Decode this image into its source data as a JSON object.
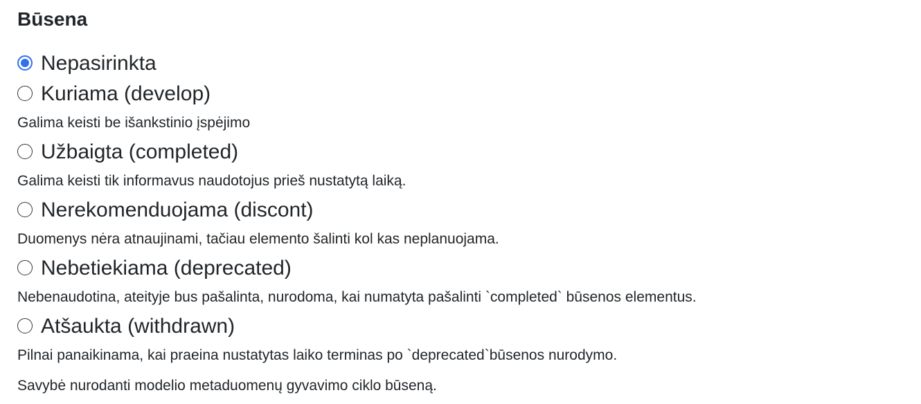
{
  "field": {
    "legend": "Būsena",
    "options": [
      {
        "label": "Nepasirinkta",
        "description": "",
        "checked": true
      },
      {
        "label": "Kuriama (develop)",
        "description": "Galima keisti be išankstinio įspėjimo",
        "checked": false
      },
      {
        "label": "Užbaigta (completed)",
        "description": "Galima keisti tik informavus naudotojus prieš nustatytą laiką.",
        "checked": false
      },
      {
        "label": "Nerekomenduojama (discont)",
        "description": "Duomenys nėra atnaujinami, tačiau elemento šalinti kol kas neplanuojama.",
        "checked": false
      },
      {
        "label": "Nebetiekiama (deprecated)",
        "description": "Nebenaudotina, ateityje bus pašalinta, nurodoma, kai numatyta pašalinti `completed` būsenos elementus.",
        "checked": false
      },
      {
        "label": "Atšaukta (withdrawn)",
        "description": "Pilnai panaikinama, kai praeina nustatytas laiko terminas po `deprecated`būsenos nurodymo.",
        "checked": false
      }
    ],
    "help_text": "Savybė nurodanti modelio metaduomenų gyvavimo ciklo būseną.",
    "accent_color": "#2f6ff0"
  }
}
